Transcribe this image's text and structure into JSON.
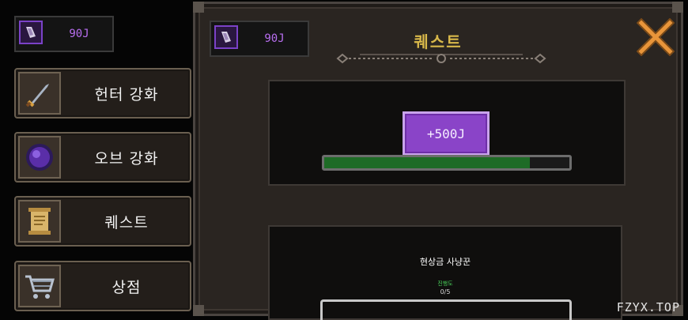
{
  "currency": {
    "value": "90J"
  },
  "sidebar": {
    "items": [
      {
        "label": "헌터 강화",
        "icon": "sword-icon"
      },
      {
        "label": "오브 강화",
        "icon": "orb-icon"
      },
      {
        "label": "퀘스트",
        "icon": "scroll-icon"
      },
      {
        "label": "상점",
        "icon": "cart-icon"
      }
    ]
  },
  "panel": {
    "title": "퀘스트",
    "currency_value": "90J",
    "reward": {
      "label": "+500J",
      "progress": 0.84
    },
    "quest": {
      "name": "현상금 사냥꾼",
      "status": "진행도",
      "progress": "0/5"
    }
  },
  "watermark": "FZYX.TOP",
  "colors": {
    "accent_purple": "#8a44c8",
    "title_gold": "#d8b84a",
    "progress_green": "#1e6b26",
    "close_orange": "#e8953a"
  }
}
